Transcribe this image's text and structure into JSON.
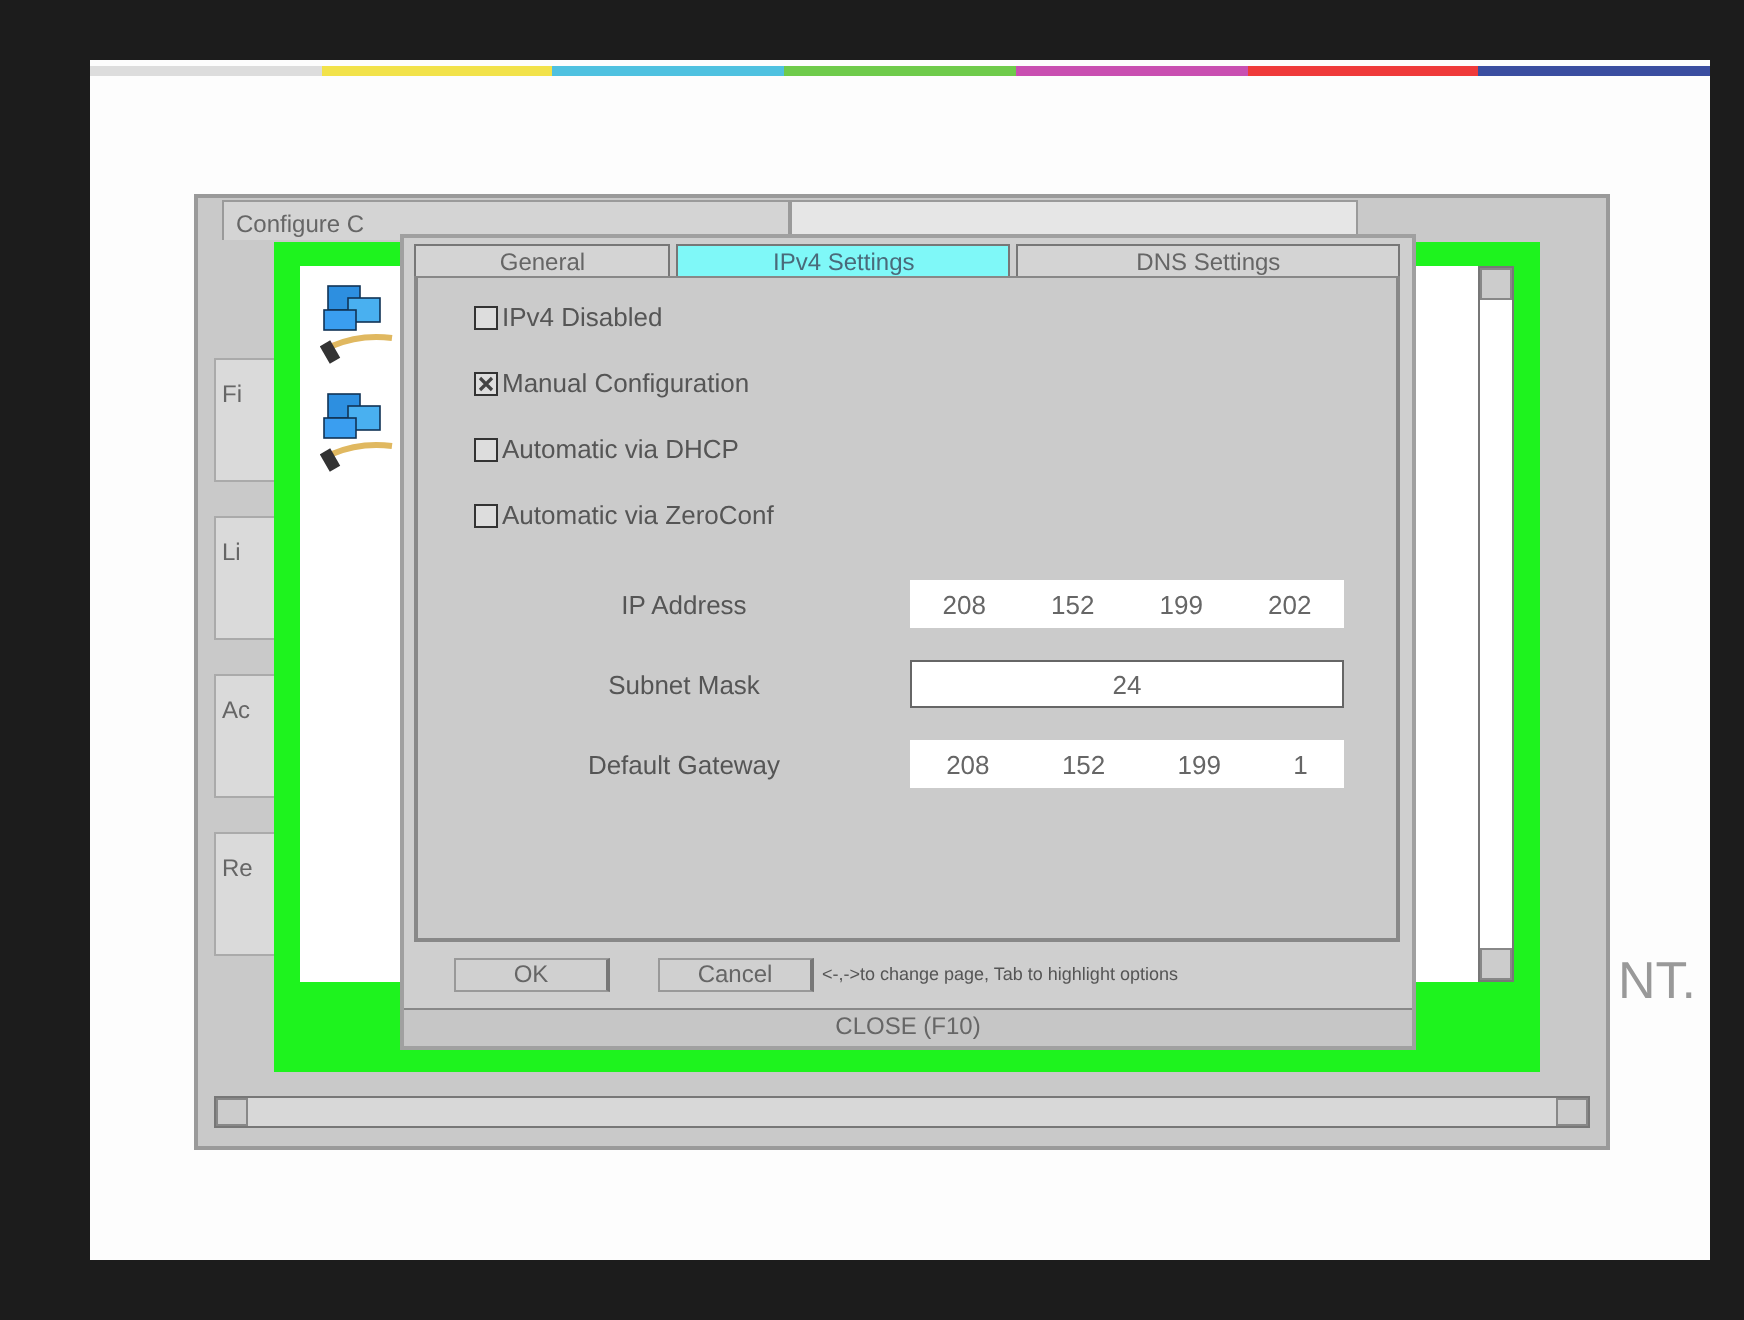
{
  "background_window": {
    "tabs": [
      {
        "label": "Configure C"
      }
    ],
    "side_tabs": [
      "Fi",
      "Li",
      "Ac",
      "Re"
    ]
  },
  "dialog": {
    "tabs": [
      {
        "label": "General",
        "selected": false
      },
      {
        "label": "IPv4 Settings",
        "selected": true
      },
      {
        "label": "DNS Settings",
        "selected": false
      }
    ],
    "options": [
      {
        "label": "IPv4 Disabled",
        "checked": false
      },
      {
        "label": "Manual Configuration",
        "checked": true
      },
      {
        "label": "Automatic via DHCP",
        "checked": false
      },
      {
        "label": "Automatic via ZeroConf",
        "checked": false
      }
    ],
    "fields": [
      {
        "label": "IP Address",
        "kind": "octets",
        "values": [
          "208",
          "152",
          "199",
          "202"
        ]
      },
      {
        "label": "Subnet Mask",
        "kind": "single",
        "value": "24"
      },
      {
        "label": "Default Gateway",
        "kind": "octets",
        "values": [
          "208",
          "152",
          "199",
          "1"
        ]
      }
    ],
    "buttons": [
      "OK",
      "Cancel"
    ],
    "hint": "<-,->to change page, Tab to highlight options",
    "close_bar": "CLOSE (F10)"
  },
  "page_text": "NT."
}
